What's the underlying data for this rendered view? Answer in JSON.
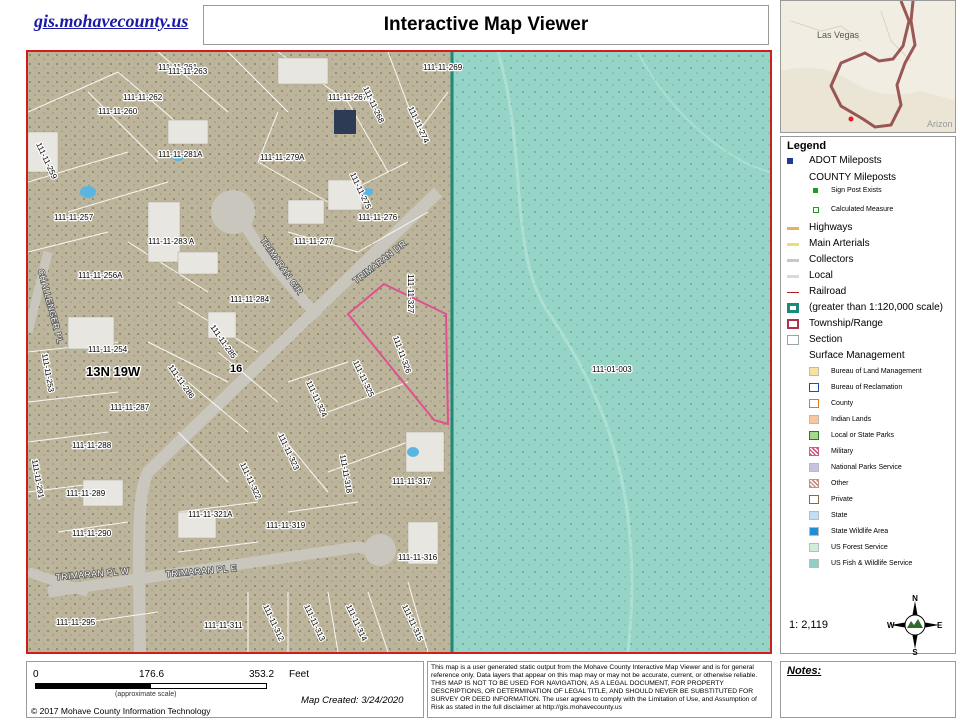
{
  "site_link": "gis.mohavecounty.us",
  "title": "Interactive Map Viewer",
  "overview": {
    "city_label": "Las Vegas",
    "state_label": "Arizon"
  },
  "map": {
    "township_label": "13N 19W",
    "section_label": "16",
    "big_parcel": "111-01-003",
    "streets": [
      "TRIMARAN DR",
      "TRIMARAN CIR",
      "CHALLENGER PL",
      "TRIMARAN PL W",
      "TRIMARAN PL E"
    ],
    "parcels": [
      {
        "id": "111-11-261"
      },
      {
        "id": "111-11-262"
      },
      {
        "id": "111-11-263"
      },
      {
        "id": "111-11-267A"
      },
      {
        "id": "111-11-268"
      },
      {
        "id": "111-11-269"
      },
      {
        "id": "111-11-260"
      },
      {
        "id": "111-11-259"
      },
      {
        "id": "111-11-281A"
      },
      {
        "id": "111-11-279A"
      },
      {
        "id": "111-11-274"
      },
      {
        "id": "111-11-275"
      },
      {
        "id": "111-11-257"
      },
      {
        "id": "111-11-276"
      },
      {
        "id": "111-11-283 A"
      },
      {
        "id": "111-11-277"
      },
      {
        "id": "111-11-256A"
      },
      {
        "id": "111-11-284"
      },
      {
        "id": "111-11-327"
      },
      {
        "id": "111-11-254"
      },
      {
        "id": "111-11-285"
      },
      {
        "id": "111-11-326"
      },
      {
        "id": "111-11-253"
      },
      {
        "id": "111-11-286"
      },
      {
        "id": "111-11-325"
      },
      {
        "id": "111-11-287"
      },
      {
        "id": "111-11-324"
      },
      {
        "id": "111-11-288"
      },
      {
        "id": "111-11-323"
      },
      {
        "id": "111-11-291"
      },
      {
        "id": "111-11-318"
      },
      {
        "id": "111-11-322"
      },
      {
        "id": "111-11-317"
      },
      {
        "id": "111-11-289"
      },
      {
        "id": "111-11-321A"
      },
      {
        "id": "111-11-290"
      },
      {
        "id": "111-11-319"
      },
      {
        "id": "111-11-316"
      },
      {
        "id": "111-11-295"
      },
      {
        "id": "111-11-311"
      },
      {
        "id": "111-11-312"
      },
      {
        "id": "111-11-313"
      },
      {
        "id": "111-11-314"
      },
      {
        "id": "111-11-315"
      }
    ]
  },
  "legend": {
    "title": "Legend",
    "items": [
      {
        "label": "ADOT Mileposts",
        "style": "adot",
        "color": "#1f3a93"
      },
      {
        "label": "COUNTY Mileposts",
        "style": "none"
      },
      {
        "label": "Sign Post Exists",
        "style": "sign",
        "color": "#1f9a1f",
        "small": true
      },
      {
        "label": "Calculated Measure",
        "style": "calc",
        "color": "#1f9a1f",
        "small": true
      },
      {
        "label": "Highways",
        "style": "line",
        "color": "#e8b060"
      },
      {
        "label": "Main Arterials",
        "style": "line",
        "color": "#e6e070"
      },
      {
        "label": "Collectors",
        "style": "line",
        "color": "#c8c8c8"
      },
      {
        "label": "Local",
        "style": "line",
        "color": "#d8d8d8"
      },
      {
        "label": "Railroad",
        "style": "rail",
        "color": "#b02020"
      },
      {
        "label": "(greater than 1:120,000 scale)",
        "style": "box-thick",
        "color": "#1a8a7a"
      },
      {
        "label": "Township/Range",
        "style": "box-dash",
        "color": "#b03050"
      },
      {
        "label": "Section",
        "style": "box-thin",
        "color": "#9aa3a8"
      },
      {
        "label": "Surface Management",
        "style": "none"
      },
      {
        "label": "Bureau of Land Management",
        "style": "fill",
        "color": "#fbe1a0",
        "small": true
      },
      {
        "label": "Bureau of Reclamation",
        "style": "outline",
        "color": "#2050a0",
        "small": true
      },
      {
        "label": "County",
        "style": "outline",
        "color": "#e07a20",
        "small": true
      },
      {
        "label": "Indian Lands",
        "style": "fill",
        "color": "#f7c8a0",
        "small": true
      },
      {
        "label": "Local or State Parks",
        "style": "fill-border",
        "color": "#a6d88f",
        "small": true
      },
      {
        "label": "Military",
        "style": "hatch",
        "color": "#d06080",
        "small": true
      },
      {
        "label": "National Parks Service",
        "style": "fill",
        "color": "#c9c2de",
        "small": true
      },
      {
        "label": "Other",
        "style": "hatch",
        "color": "#c89080",
        "small": true
      },
      {
        "label": "Private",
        "style": "outline",
        "color": "#8a6a40",
        "small": true
      },
      {
        "label": "State",
        "style": "fill",
        "color": "#bfe0f5",
        "small": true
      },
      {
        "label": "State Wildlife Area",
        "style": "fill",
        "color": "#1e8fd6",
        "small": true
      },
      {
        "label": "US Forest Service",
        "style": "fill",
        "color": "#d2ecd8",
        "small": true
      },
      {
        "label": "US Fish & Wildlife Service",
        "style": "fill",
        "color": "#8fd0c2",
        "small": true
      }
    ],
    "scale_ratio": "1: 2,119",
    "compass": {
      "n": "N",
      "s": "S",
      "e": "E",
      "w": "W"
    }
  },
  "scale_bar": {
    "start": "0",
    "mid": "176.6",
    "end": "353.2",
    "unit": "Feet",
    "approx": "(approximate scale)",
    "created": "Map Created: 3/24/2020",
    "copyright": "© 2017 Mohave County Information Technology"
  },
  "notice": "This map is a user generated static output from the Mohave County Interactive Map Viewer and is for general reference only. Data layers that appear on this map may or may not be accurate, current, or otherwise reliable. THIS MAP IS NOT TO BE USED FOR NAVIGATION, AS A LEGAL DOCUMENT, FOR PROPERTY DESCRIPTIONS, OR DETERMINATION OF LEGAL TITLE, AND SHOULD NEVER BE SUBSTITUTED FOR SURVEY OR DEED INFORMATION. The user agrees to comply with the Limitation of Use, and Assumption of Risk as stated in the full disclaimer at http://gis.mohavecounty.us",
  "notes_label": "Notes:",
  "colors": {
    "frame": "#cc1f1f",
    "parcel_line": "#ffffff",
    "highlight": "#e05090",
    "wildlife": "#8fd0c2",
    "section_line": "#1a8a7a"
  }
}
